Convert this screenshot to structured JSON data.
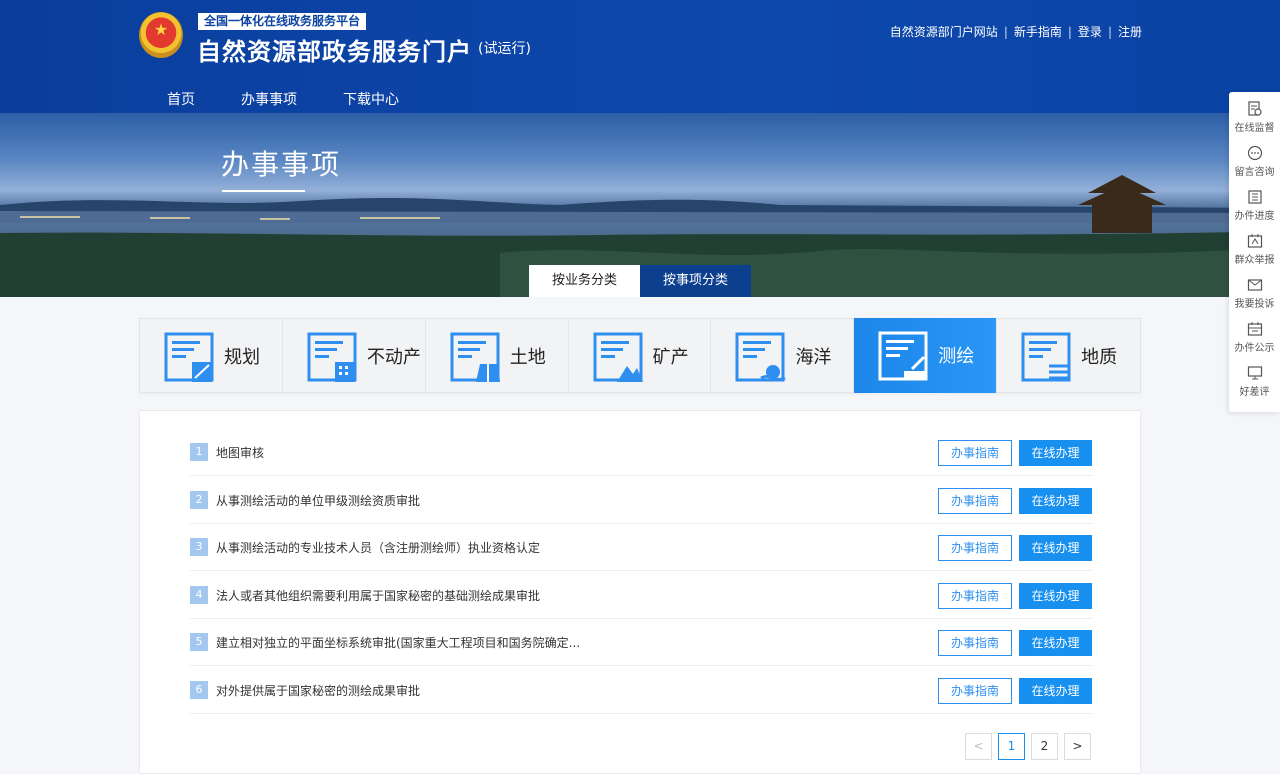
{
  "header": {
    "platform_tag": "全国一体化在线政务服务平台",
    "title": "自然资源部政务服务门户",
    "subtitle": "(试运行)",
    "links": [
      "自然资源部门户网站",
      "新手指南",
      "登录",
      "注册"
    ]
  },
  "nav": {
    "items": [
      {
        "label": "首页",
        "active": false
      },
      {
        "label": "办事事项",
        "active": true
      },
      {
        "label": "下载中心",
        "active": false
      }
    ]
  },
  "banner": {
    "title": "办事事项",
    "tabs": [
      {
        "label": "按业务分类",
        "active": true
      },
      {
        "label": "按事项分类",
        "active": false
      }
    ]
  },
  "categories": [
    {
      "label": "规划",
      "icon": "planning-icon",
      "active": false
    },
    {
      "label": "不动产",
      "icon": "real-estate-icon",
      "active": false
    },
    {
      "label": "土地",
      "icon": "land-icon",
      "active": false
    },
    {
      "label": "矿产",
      "icon": "mineral-icon",
      "active": false
    },
    {
      "label": "海洋",
      "icon": "ocean-icon",
      "active": false
    },
    {
      "label": "测绘",
      "icon": "surveying-icon",
      "active": true
    },
    {
      "label": "地质",
      "icon": "geology-icon",
      "active": false
    }
  ],
  "items": [
    {
      "num": "1",
      "title": "地图审核"
    },
    {
      "num": "2",
      "title": "从事测绘活动的单位甲级测绘资质审批"
    },
    {
      "num": "3",
      "title": "从事测绘活动的专业技术人员（含注册测绘师）执业资格认定"
    },
    {
      "num": "4",
      "title": "法人或者其他组织需要利用属于国家秘密的基础测绘成果审批"
    },
    {
      "num": "5",
      "title": "建立相对独立的平面坐标系统审批(国家重大工程项目和国务院确定..."
    },
    {
      "num": "6",
      "title": "对外提供属于国家秘密的测绘成果审批"
    }
  ],
  "buttons": {
    "guide": "办事指南",
    "online": "在线办理"
  },
  "pagination": {
    "prev": "<",
    "pages": [
      "1",
      "2"
    ],
    "current": "1",
    "next": ">"
  },
  "float_bar": [
    {
      "label": "在线监督",
      "icon": "supervision-icon"
    },
    {
      "label": "留言咨询",
      "icon": "message-icon"
    },
    {
      "label": "办件进度",
      "icon": "progress-icon"
    },
    {
      "label": "群众举报",
      "icon": "report-icon"
    },
    {
      "label": "我要投诉",
      "icon": "mail-icon"
    },
    {
      "label": "办件公示",
      "icon": "calendar-icon"
    },
    {
      "label": "好差评",
      "icon": "monitor-icon"
    }
  ],
  "colors": {
    "header_blue": "#0c43a3",
    "accent_blue": "#1890f0",
    "active_category": "#1c86e9",
    "tab_dark": "#0d3f8f"
  }
}
